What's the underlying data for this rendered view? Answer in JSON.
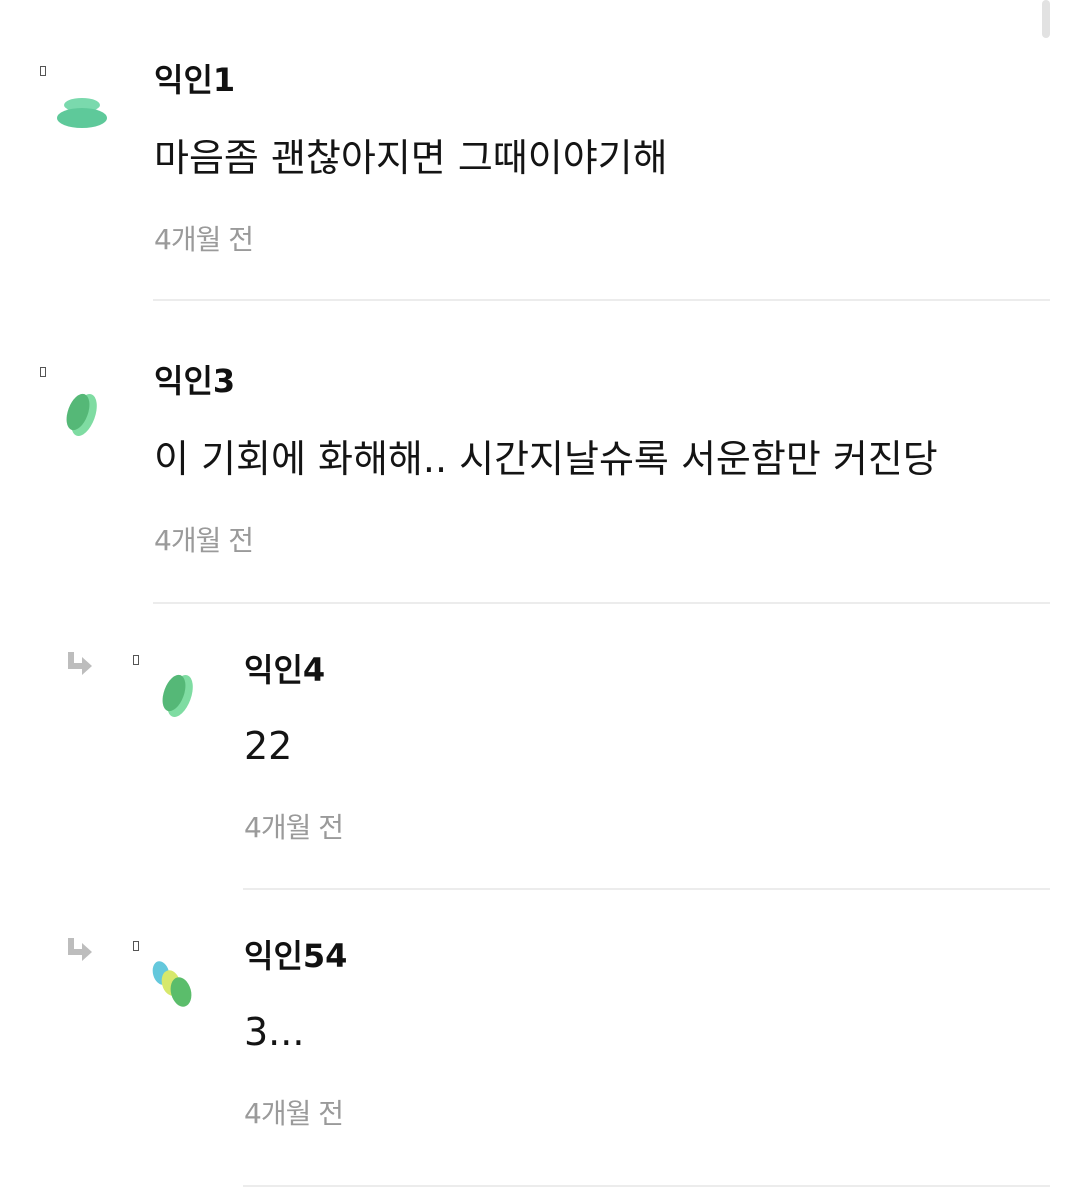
{
  "comments": [
    {
      "nickname": "익인1",
      "text": "마음좀 괜찮아지면 그때이야기해",
      "time": "4개월 전",
      "avatar_icon": "mint-stacked-blob-icon",
      "is_reply": false
    },
    {
      "nickname": "익인3",
      "text": "이 기회에 화해해.. 시간지날슈록 서운함만 커진당",
      "time": "4개월 전",
      "avatar_icon": "green-leaf-blob-icon",
      "is_reply": false
    },
    {
      "nickname": "익인4",
      "text": "22",
      "time": "4개월 전",
      "avatar_icon": "green-leaf-blob-icon",
      "is_reply": true
    },
    {
      "nickname": "익인54",
      "text": "3...",
      "time": "4개월 전",
      "avatar_icon": "tricolor-blob-icon",
      "is_reply": true
    }
  ],
  "colors": {
    "mint": "#6cd3a4",
    "mint_dark": "#4dbb8a",
    "green": "#5bbd7b",
    "green_light": "#7fdca2",
    "cyan": "#64c8dc",
    "lime": "#d7e86c",
    "timestamp": "#9a9a9a",
    "divider": "#ececec"
  }
}
